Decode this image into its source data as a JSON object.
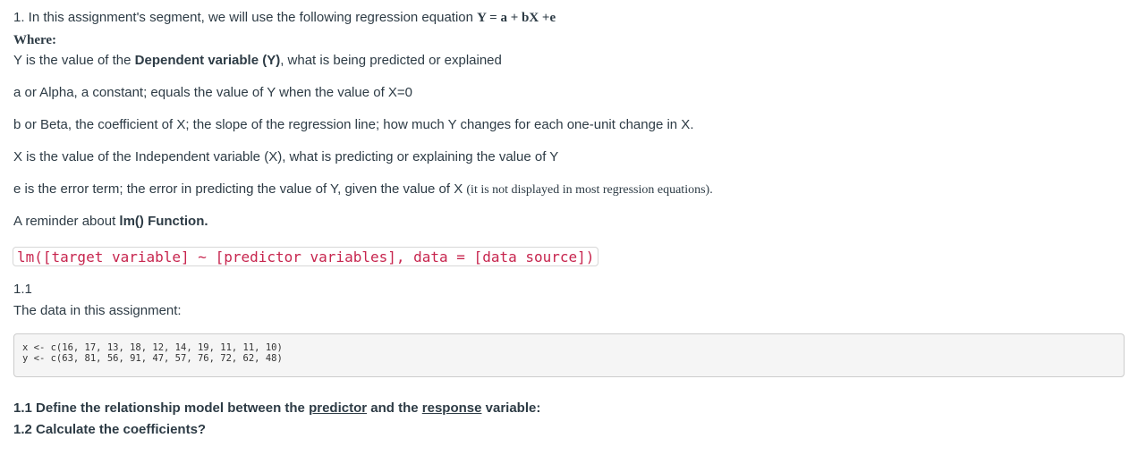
{
  "intro": {
    "text": "1. In this assignment's segment, we will use the following regression equation ",
    "equation": "Y = a + bX +e"
  },
  "where_label": "Where:",
  "definitions": {
    "y": {
      "prefix": "Y is the value of the ",
      "bold": "Dependent variable (Y)",
      "suffix": ", what is being predicted or explained"
    },
    "a": "a or Alpha, a constant; equals the value of Y when the value of X=0",
    "b": "b or Beta, the coefficient of X; the slope of the regression line; how much Y changes for each one-unit change in X.",
    "x": "X is the value of the Independent variable (X), what is predicting or explaining the value of Y",
    "e": {
      "text": "e is the error term; the error in predicting the value of Y, given the value of X ",
      "note": "(it is not displayed in most regression equations)."
    }
  },
  "reminder": {
    "prefix": "A reminder about ",
    "bold": "lm() Function."
  },
  "code_inline": {
    "part1": "lm([target variable] ",
    "tilde": "~",
    "part2": " [predictor variables], data = [data source])"
  },
  "section": {
    "number": "1.1",
    "description": "The data in this assignment:"
  },
  "code_block": {
    "line1": "x <- c(16, 17, 13, 18, 12, 14, 19, 11, 11, 10)",
    "line2": "y <- c(63, 81, 56, 91, 47, 57, 76, 72, 62, 48)"
  },
  "questions": {
    "q1": {
      "prefix": "1.1 Define the relationship model between the ",
      "link1": "predictor",
      "mid": " and the ",
      "link2": "response",
      "suffix": " variable:"
    },
    "q2": "1.2 Calculate the coefficients?"
  }
}
